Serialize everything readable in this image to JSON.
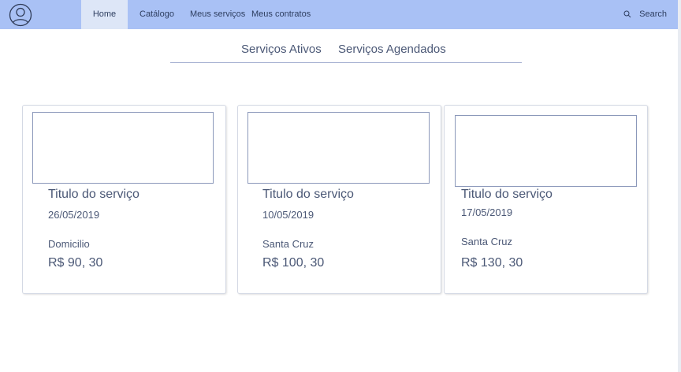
{
  "nav": {
    "items": [
      {
        "label": "Home",
        "active": true
      },
      {
        "label": "Catálogo"
      },
      {
        "label": "Meus serviços"
      },
      {
        "label": "Meus contratos"
      }
    ],
    "search_label": "Search",
    "icons": {
      "avatar": "user-circle-icon",
      "search": "search-icon"
    }
  },
  "tabs": [
    "Serviços Ativos",
    "Serviços Agendados"
  ],
  "cards": [
    {
      "title": "Titulo do serviço",
      "date": "26/05/2019",
      "location": "Domicilio",
      "price": "R$ 90, 30"
    },
    {
      "title": "Titulo do serviço",
      "date": "10/05/2019",
      "location": "Santa Cruz",
      "price": "R$ 100, 30"
    },
    {
      "title": "Titulo do serviço",
      "date": "17/05/2019",
      "location": "Santa Cruz",
      "price": "R$ 130, 30"
    }
  ],
  "colors": {
    "navbar": "#a9c1f5",
    "active_nav": "#dde6f7",
    "text": "#4b5876",
    "image_border": "#8b98ba"
  }
}
